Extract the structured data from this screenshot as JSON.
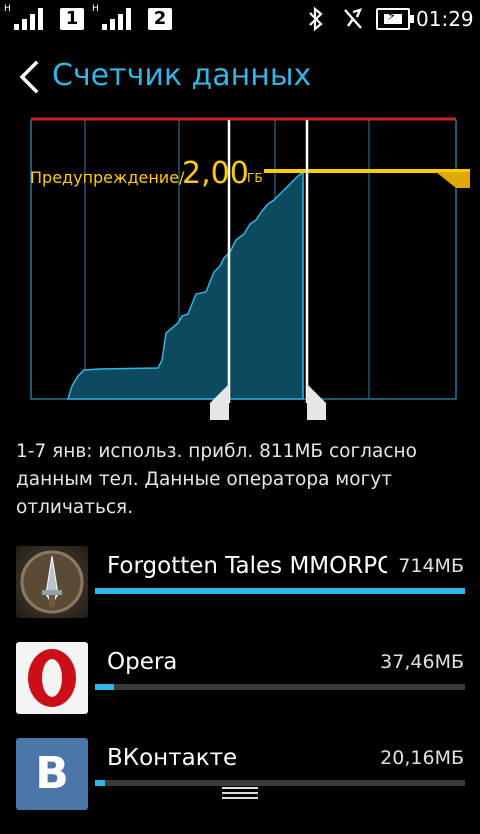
{
  "status_bar": {
    "network_label_1": "H",
    "sim1": "1",
    "network_label_2": "H",
    "sim2": "2",
    "time": "01:29",
    "icons": [
      "bluetooth-icon",
      "data-off-icon",
      "battery-charging-icon"
    ]
  },
  "header": {
    "title": "Счетчик данных"
  },
  "chart": {
    "warning_label": "Предупреждение/",
    "warning_value": "2,00",
    "warning_unit": "ГБ",
    "colors": {
      "limit_line": "#cc2222",
      "warning_line": "#ffcc00",
      "area_fill": "#0e4a5e",
      "area_stroke": "#33b5e5",
      "grid": "#33b5e5"
    }
  },
  "summary": {
    "text": "1-7 янв: использ. прибл. 811МБ согласно данным тел. Данные оператора могут отличаться."
  },
  "apps": [
    {
      "name": "Forgotten Tales MMORPG",
      "size": "714МБ",
      "usage_fraction": 1.0,
      "icon": "forgotten-tales-icon"
    },
    {
      "name": "Opera",
      "size": "37,46МБ",
      "usage_fraction": 0.052,
      "icon": "opera-icon"
    },
    {
      "name": "ВКонтакте",
      "size": "20,16МБ",
      "usage_fraction": 0.028,
      "icon": "vkontakte-icon",
      "icon_letter": "B"
    }
  ]
}
